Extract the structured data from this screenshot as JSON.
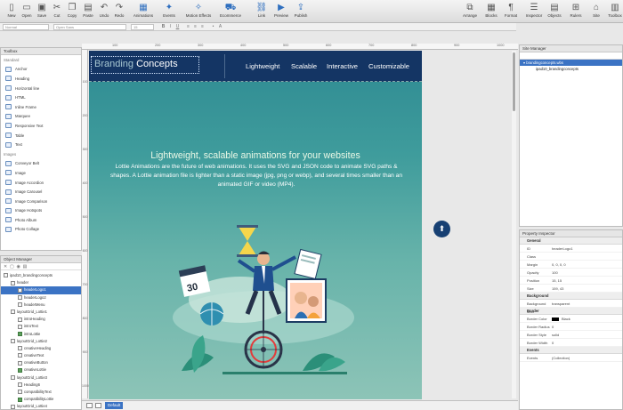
{
  "toolbar": {
    "buttons": [
      {
        "label": "New",
        "icon": "new-doc-icon"
      },
      {
        "label": "Open",
        "icon": "open-folder-icon"
      },
      {
        "label": "Save",
        "icon": "save-icon"
      },
      {
        "label": "Cut",
        "icon": "cut-icon"
      },
      {
        "label": "Copy",
        "icon": "copy-icon"
      },
      {
        "label": "Paste",
        "icon": "paste-icon"
      },
      {
        "label": "Undo",
        "icon": "undo-icon"
      },
      {
        "label": "Redo",
        "icon": "redo-icon"
      },
      {
        "label": "Animations",
        "icon": "animations-icon"
      },
      {
        "label": "Events",
        "icon": "events-icon"
      },
      {
        "label": "Motion Effects",
        "icon": "motion-effects-icon"
      },
      {
        "label": "Ecommerce",
        "icon": "cart-icon"
      },
      {
        "label": "Link",
        "icon": "link-icon"
      },
      {
        "label": "Preview",
        "icon": "preview-icon"
      },
      {
        "label": "Publish",
        "icon": "publish-icon"
      },
      {
        "label": "Arrange",
        "icon": "arrange-icon"
      },
      {
        "label": "Blocks",
        "icon": "blocks-icon"
      },
      {
        "label": "Format",
        "icon": "format-icon"
      },
      {
        "label": "Inspector",
        "icon": "inspector-icon"
      },
      {
        "label": "Objects",
        "icon": "objects-icon"
      },
      {
        "label": "Rulers",
        "icon": "rulers-icon"
      },
      {
        "label": "Site",
        "icon": "site-icon"
      },
      {
        "label": "Toolbox",
        "icon": "toolbox-icon"
      }
    ]
  },
  "format_bar": {
    "paragraph": "Normal",
    "font": "Open Sans",
    "size": "15"
  },
  "toolbox": {
    "title": "Toolbox",
    "items": [
      {
        "label": "Standard",
        "cat": true
      },
      {
        "label": "Anchor",
        "icon": "anchor-icon"
      },
      {
        "label": "Heading",
        "icon": "heading-icon"
      },
      {
        "label": "Horizontal line",
        "icon": "horizontal-line-icon"
      },
      {
        "label": "HTML",
        "icon": "html-icon"
      },
      {
        "label": "Inline Frame",
        "icon": "inline-frame-icon"
      },
      {
        "label": "Marquee",
        "icon": "marquee-icon"
      },
      {
        "label": "Responsive Text",
        "icon": "responsive-text-icon"
      },
      {
        "label": "Table",
        "icon": "table-icon"
      },
      {
        "label": "Text",
        "icon": "text-icon"
      },
      {
        "label": "Images",
        "cat": true
      },
      {
        "label": "Conveyor Belt",
        "icon": "conveyor-belt-icon"
      },
      {
        "label": "Image",
        "icon": "image-icon"
      },
      {
        "label": "Image Accordion",
        "icon": "image-accordion-icon"
      },
      {
        "label": "Image Carousel",
        "icon": "image-carousel-icon"
      },
      {
        "label": "Image Comparison",
        "icon": "image-comparison-icon"
      },
      {
        "label": "Image Hotspots",
        "icon": "image-hotspots-icon"
      },
      {
        "label": "Photo Album",
        "icon": "photo-album-icon"
      },
      {
        "label": "Photo Collage",
        "icon": "photo-collage-icon"
      }
    ]
  },
  "object_manager": {
    "title": "Object Manager",
    "items": [
      {
        "label": "ipad10_brandingconcepts",
        "indent": 0,
        "icon": "page-icon"
      },
      {
        "label": "header",
        "indent": 1,
        "icon": "folder-icon"
      },
      {
        "label": "headerLogo1",
        "indent": 2,
        "icon": "image-icon",
        "selected": true
      },
      {
        "label": "headerLogo2",
        "indent": 2,
        "icon": "image-icon"
      },
      {
        "label": "headerMenu",
        "indent": 2,
        "icon": "menu-icon"
      },
      {
        "label": "layoutGrid_Lottie1",
        "indent": 1,
        "icon": "grid-icon"
      },
      {
        "label": "introHeading",
        "indent": 2,
        "icon": "heading-icon"
      },
      {
        "label": "introText",
        "indent": 2,
        "icon": "text-icon"
      },
      {
        "label": "introLottie",
        "indent": 2,
        "icon": "lottie-icon",
        "green": true
      },
      {
        "label": "layoutGrid_Lottie2",
        "indent": 1,
        "icon": "grid-icon"
      },
      {
        "label": "creativeHeading",
        "indent": 2,
        "icon": "heading-icon"
      },
      {
        "label": "creativeText",
        "indent": 2,
        "icon": "text-icon"
      },
      {
        "label": "creativeButton",
        "indent": 2,
        "icon": "button-icon"
      },
      {
        "label": "creativeLottie",
        "indent": 2,
        "icon": "lottie-icon",
        "green": true
      },
      {
        "label": "layoutGrid_Lottie3",
        "indent": 1,
        "icon": "grid-icon"
      },
      {
        "label": "Heading6",
        "indent": 2,
        "icon": "heading-icon"
      },
      {
        "label": "compatibilityText",
        "indent": 2,
        "icon": "text-icon"
      },
      {
        "label": "compatibilityLottie",
        "indent": 2,
        "icon": "lottie-icon",
        "green": true
      },
      {
        "label": "layoutGrid_Lottie4",
        "indent": 1,
        "icon": "grid-icon"
      }
    ]
  },
  "rulers": {
    "h_ticks": [
      "100",
      "200",
      "300",
      "400",
      "500",
      "600",
      "700",
      "800",
      "900",
      "1000"
    ],
    "v_ticks": [
      "100",
      "200",
      "300",
      "400",
      "500",
      "600",
      "700",
      "800",
      "900",
      "1000"
    ]
  },
  "canvas": {
    "logo_part1": "Branding",
    "logo_part2": "Concepts",
    "menu": [
      "Lightweight",
      "Scalable",
      "Interactive",
      "Customizable"
    ],
    "hero_title": "Lightweight, scalable animations for your websites",
    "hero_text": "Lottie Animations are the future of web animations. It uses the SVG and JSON code to animate SVG paths & shapes. A Lottie animation file is lighter than a static image (jpg, png or webp), and several times smaller than an animated GIF or video (MP4).",
    "calendar_number": "30",
    "scroll_top_icon": "arrow-up-icon"
  },
  "bottom_bar": {
    "breakpoint": "Default"
  },
  "site_manager": {
    "title": "Site Manager",
    "items": [
      {
        "label": "brandingconcepts.wbs",
        "selected": true
      },
      {
        "label": "ipad10_brandingconcepts",
        "selected": false
      }
    ]
  },
  "property_inspector": {
    "title": "Property Inspector",
    "sections": [
      {
        "name": "General",
        "rows": [
          {
            "k": "ID",
            "v": "headerLogo1"
          },
          {
            "k": "Class",
            "v": ""
          },
          {
            "k": "Margin",
            "v": "0, 0, 0, 0"
          },
          {
            "k": "Opacity",
            "v": "100"
          },
          {
            "k": "Position",
            "v": "15, 15"
          },
          {
            "k": "Size",
            "v": "159, 43"
          }
        ]
      },
      {
        "name": "Background",
        "rows": [
          {
            "k": "Background Mod",
            "v": "transparent"
          }
        ]
      },
      {
        "name": "Border",
        "rows": [
          {
            "k": "Border Color",
            "v": "Black",
            "swatch": "#000000"
          },
          {
            "k": "Border Radius",
            "v": "0"
          },
          {
            "k": "Border Style",
            "v": "solid"
          },
          {
            "k": "Border Width",
            "v": "0"
          }
        ]
      },
      {
        "name": "Events",
        "rows": [
          {
            "k": "Events",
            "v": "(Collection)"
          }
        ]
      }
    ]
  },
  "colors": {
    "header_bg": "#143564",
    "accent": "#3b73c4",
    "hero_top": "#2e8a92",
    "hero_bottom": "#8dc4b7"
  }
}
